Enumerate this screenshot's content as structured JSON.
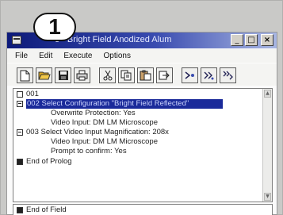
{
  "step_badge": "1",
  "window": {
    "title": "e - Bright Field Anodized Alum",
    "buttons": {
      "minimize": "_",
      "maximize": "□",
      "close": "×"
    }
  },
  "menu": [
    "File",
    "Edit",
    "Execute",
    "Options"
  ],
  "toolbar": {
    "buttons": [
      "new-icon",
      "open-folder-icon",
      "save-icon",
      "print-icon",
      "cut-icon",
      "copy-icon",
      "paste-icon",
      "insert-icon",
      "step-icon",
      "run-icon",
      "run-all-icon"
    ]
  },
  "tree": {
    "rows": [
      {
        "text": "001",
        "icon": "box",
        "indent": 0
      },
      {
        "text": "002 Select Configuration \"Bright Field Reflected\"",
        "icon": "box-minus",
        "indent": 0,
        "selected": true
      },
      {
        "text": "Overwrite Protection: Yes",
        "indent": 1
      },
      {
        "text": "Video Input: DM LM Microscope",
        "indent": 1
      },
      {
        "text": "003 Select Video Input Magnification: 208x",
        "icon": "box-minus",
        "indent": 0
      },
      {
        "text": "Video Input: DM LM Microscope",
        "indent": 1
      },
      {
        "text": "Prompt to confirm: Yes",
        "indent": 1
      },
      {
        "text": "End of Prolog",
        "icon": "box-filled",
        "indent": 0
      }
    ]
  },
  "bottom_pane": {
    "rows": [
      {
        "text": "End of Field",
        "icon": "box-filled"
      }
    ]
  },
  "colors": {
    "titlebar_start": "#0d1a7a",
    "selection": "#1a2a9a"
  }
}
